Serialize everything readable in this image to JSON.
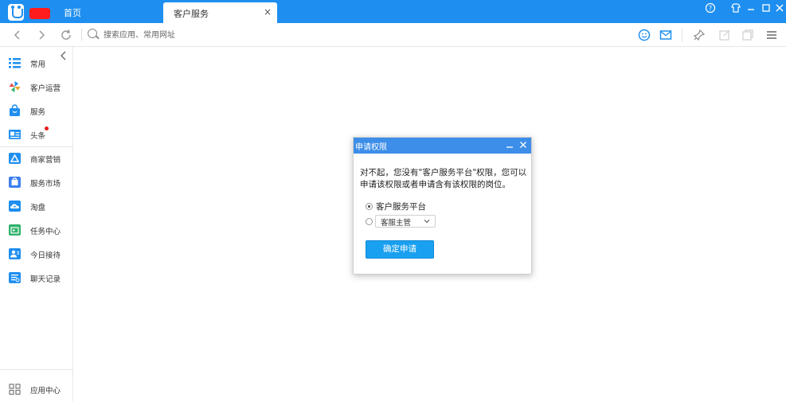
{
  "titlebar": {
    "tabs": [
      {
        "label": "首页"
      },
      {
        "label": "客户服务"
      }
    ],
    "close_glyph": "×",
    "controls": [
      "help-icon",
      "shirt-icon",
      "minimize-icon",
      "maximize-icon",
      "close-icon"
    ]
  },
  "toolbar": {
    "search_placeholder": "搜索应用、常用网址"
  },
  "sidebar": {
    "items": [
      {
        "label": "常用",
        "icon": "list-icon",
        "color": "#1e8ff0"
      },
      {
        "label": "客户运营",
        "icon": "pinwheel-icon",
        "color": "#1e8ff0"
      },
      {
        "label": "服务",
        "icon": "bag-icon",
        "color": "#1e8ff0"
      },
      {
        "label": "头条",
        "icon": "news-icon",
        "color": "#1e8ff0",
        "badge": true
      },
      {
        "label": "商家营销",
        "icon": "triangle-icon",
        "color": "#1e8ff0"
      },
      {
        "label": "服务市场",
        "icon": "store-icon",
        "color": "#3d7ff0"
      },
      {
        "label": "淘盘",
        "icon": "cloud-icon",
        "color": "#1e8ff0"
      },
      {
        "label": "任务中心",
        "icon": "calendar-icon",
        "color": "#2fb36b"
      },
      {
        "label": "今日接待",
        "icon": "contact-icon",
        "color": "#1e8ff0"
      },
      {
        "label": "聊天记录",
        "icon": "record-icon",
        "color": "#1e8ff0"
      }
    ],
    "footer": {
      "label": "应用中心",
      "icon": "grid-icon"
    }
  },
  "dialog": {
    "title": "申请权限",
    "message": "对不起，您没有\"客户服务平台\"权限，您可以申请该权限或者申请含有该权限的岗位。",
    "options": [
      {
        "label": "客户服务平台",
        "checked": true
      },
      {
        "label": "客服主管",
        "checked": false
      }
    ],
    "select_value": "客服主管",
    "confirm_label": "确定申请"
  },
  "colors": {
    "titlebar": "#1e8ff0",
    "dialog_header": "#3d8ee8",
    "primary_button": "#1aa0f0"
  }
}
